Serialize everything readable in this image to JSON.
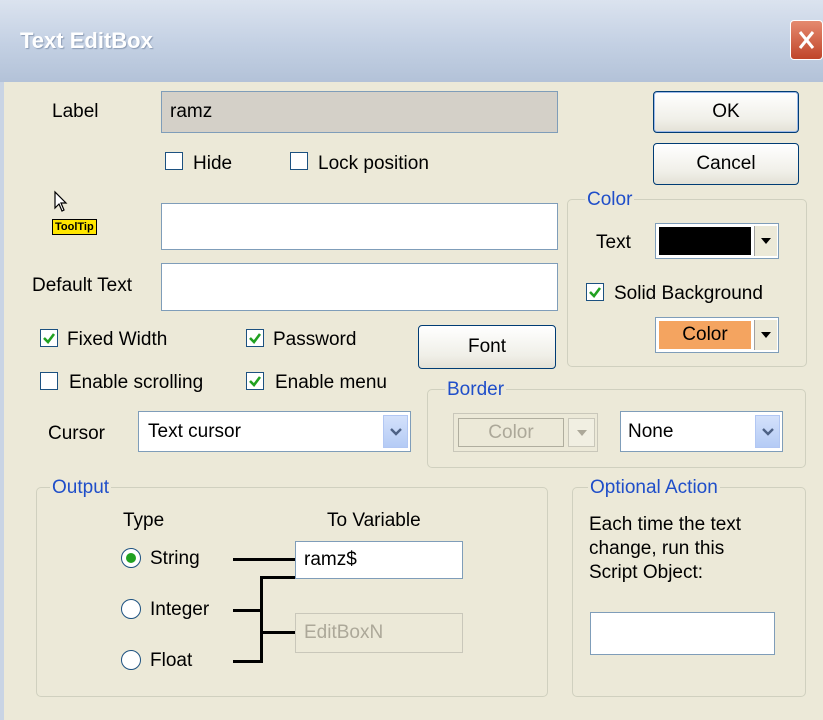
{
  "window": {
    "title": "Text EditBox"
  },
  "label_section": {
    "label": "Label",
    "value": "ramz"
  },
  "hide": {
    "label": "Hide",
    "checked": false
  },
  "lock_position": {
    "label": "Lock position",
    "checked": false
  },
  "tooltip": {
    "badge": "ToolTip",
    "value": ""
  },
  "default_text": {
    "label": "Default Text",
    "value": ""
  },
  "options": {
    "fixed_width": {
      "label": "Fixed Width",
      "checked": true
    },
    "password": {
      "label": "Password",
      "checked": true
    },
    "enable_scrolling": {
      "label": "Enable scrolling",
      "checked": false
    },
    "enable_menu": {
      "label": "Enable menu",
      "checked": true
    }
  },
  "buttons": {
    "ok": "OK",
    "cancel": "Cancel",
    "font": "Font"
  },
  "color_group": {
    "legend": "Color",
    "text_label": "Text",
    "text_color": "#000000",
    "solid_background": {
      "label": "Solid Background",
      "checked": true
    },
    "background_button": "Color",
    "background_color": "#f4a460"
  },
  "border_group": {
    "legend": "Border",
    "color_button": "Color",
    "style": "None"
  },
  "cursor": {
    "label": "Cursor",
    "value": "Text cursor"
  },
  "output_group": {
    "legend": "Output",
    "type_header": "Type",
    "variable_header": "To Variable",
    "types": [
      {
        "label": "String",
        "selected": true
      },
      {
        "label": "Integer",
        "selected": false
      },
      {
        "label": "Float",
        "selected": false
      }
    ],
    "string_variable": "ramz$",
    "numeric_variable": "EditBoxN"
  },
  "optional_action": {
    "legend": "Optional Action",
    "line1": "Each time the text",
    "line2": "change, run this",
    "line3": "Script Object:",
    "value": ""
  },
  "colors": {
    "checkmark": "#21a121",
    "legend_text": "#1f4ec9",
    "title_bg": "#c3d0e3"
  }
}
